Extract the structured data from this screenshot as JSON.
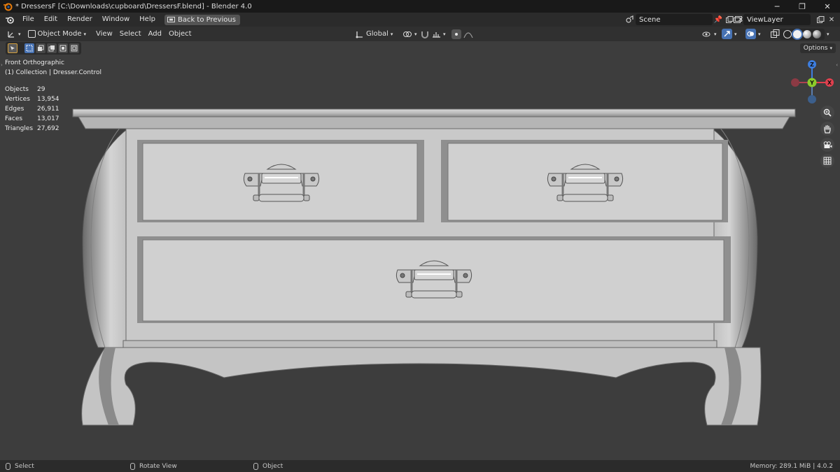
{
  "window": {
    "title": "* DressersF [C:\\Downloads\\cupboard\\DressersF.blend] - Blender 4.0",
    "minimize": "─",
    "maximize": "❐",
    "close": "✕"
  },
  "menu": {
    "items": [
      "File",
      "Edit",
      "Render",
      "Window",
      "Help"
    ],
    "back_button": "Back to Previous"
  },
  "scene": {
    "label": "Scene",
    "view_layer": "ViewLayer"
  },
  "header": {
    "mode": "Object Mode",
    "menus": [
      "View",
      "Select",
      "Add",
      "Object"
    ],
    "orientation": "Global"
  },
  "viewport": {
    "view_name": "Front Orthographic",
    "collection": "(1) Collection | Dresser.Control",
    "options": "Options",
    "stats": [
      {
        "label": "Objects",
        "value": "29"
      },
      {
        "label": "Vertices",
        "value": "13,954"
      },
      {
        "label": "Edges",
        "value": "26,911"
      },
      {
        "label": "Faces",
        "value": "13,017"
      },
      {
        "label": "Triangles",
        "value": "27,692"
      }
    ],
    "gizmo": {
      "z": "Z",
      "y": "Y",
      "x": "X"
    }
  },
  "status": {
    "select": "Select",
    "rotate": "Rotate View",
    "object": "Object",
    "memory": "Memory: 289.1 MiB | 4.0.2"
  },
  "colors": {
    "accent": "#4772b3",
    "axis_x": "#e0404e",
    "axis_y": "#8bcc2a",
    "axis_z": "#3d7ee0"
  }
}
